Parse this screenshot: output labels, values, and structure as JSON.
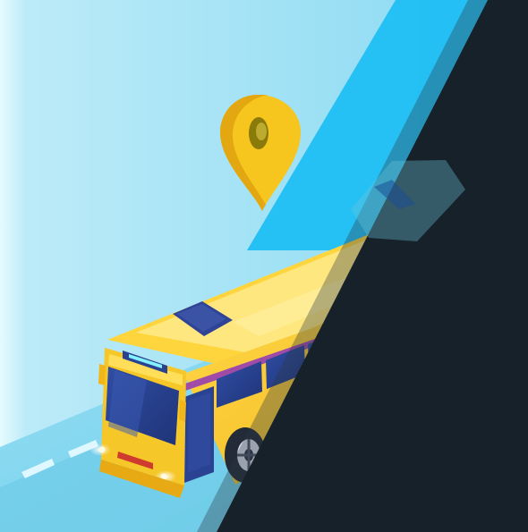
{
  "image": {
    "subject": "bus-with-location-pin",
    "colors": {
      "sky_light": "#d8f4fb",
      "sky": "#8fdcf4",
      "accent_blue": "#1fbef3",
      "dark_panel": "#17212a",
      "road": "#7fd3ef",
      "bus_body": "#f8c92b",
      "bus_roof": "#fde36d",
      "bus_window": "#2a4292",
      "bus_stripe": "#a14ba9",
      "pin": "#f7c51f",
      "pin_hole": "#8a7a09",
      "tire": "#232a38",
      "headlight": "#fff7cc"
    }
  }
}
